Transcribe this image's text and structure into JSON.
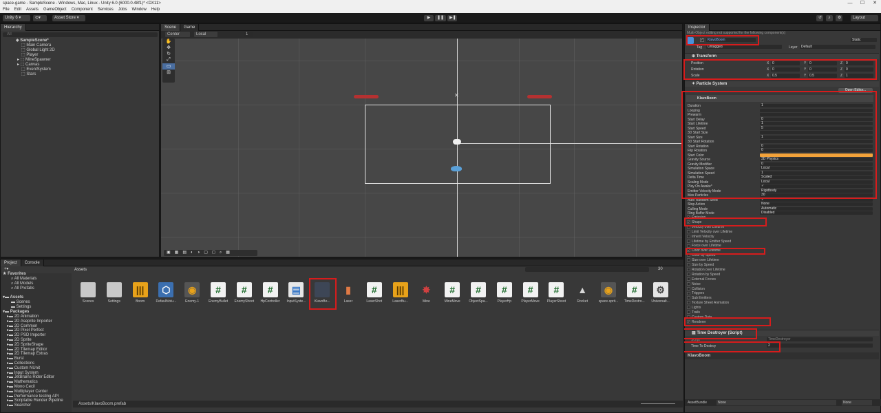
{
  "window": {
    "title": "space-game - SampleScene - Windows, Mac, Linux - Unity 6.0 (6000.0.48f1)* <DX11>",
    "min": "—",
    "max": "☐",
    "close": "✕"
  },
  "menu": [
    "File",
    "Edit",
    "Assets",
    "GameObject",
    "Component",
    "Services",
    "Jobs",
    "Window",
    "Help"
  ],
  "toolbar": {
    "account": "Unity 6",
    "account_arrow": "▾",
    "cloud": "⊙▾",
    "asset_store": "Asset Store ▾",
    "layout": "Layout",
    "play": "▶",
    "pause": "❚❚",
    "step": "▶❚"
  },
  "hierarchy": {
    "tab": "Hierarchy",
    "search_placeholder": "All",
    "items": [
      "SampleScene*",
      "Main Camera",
      "Global Light 2D",
      "Player",
      "MineSpawner",
      "Canvas",
      "EventSystem",
      "Stars"
    ]
  },
  "scene": {
    "tabs": [
      "Scene",
      "Game"
    ],
    "pivot": "Center",
    "space": "Local",
    "snap": "1"
  },
  "inspector": {
    "tab": "Inspector",
    "hint": "Multi-Object editing not supported for the following component(s)",
    "object_name": "KlavoBoom",
    "static": "Static",
    "tag_label": "Tag",
    "tag": "Untagged",
    "layer_label": "Layer",
    "layer": "Default",
    "transform": {
      "title": "Transform",
      "position_label": "Position",
      "rotation_label": "Rotation",
      "scale_label": "Scale",
      "axis_x": "X",
      "axis_y": "Y",
      "axis_z": "Z",
      "position": [
        "0",
        "0",
        "0"
      ],
      "rotation": [
        "0",
        "0",
        "0"
      ],
      "scale": [
        "0.5",
        "0.5",
        "1"
      ]
    },
    "particle": {
      "title": "Particle System",
      "open_editor": "Open Editor...",
      "sub_title": "KlavoBoom",
      "rows": [
        {
          "label": "Duration",
          "value": "1"
        },
        {
          "label": "Looping",
          "value": ""
        },
        {
          "label": "Prewarm",
          "value": ""
        },
        {
          "label": "Start Delay",
          "value": "0"
        },
        {
          "label": "Start Lifetime",
          "value": "1"
        },
        {
          "label": "Start Speed",
          "value": "5"
        },
        {
          "label": "3D Start Size",
          "value": ""
        },
        {
          "label": "Start Size",
          "value": "1"
        },
        {
          "label": "3D Start Rotation",
          "value": ""
        },
        {
          "label": "Start Rotation",
          "value": "0"
        },
        {
          "label": "Flip Rotation",
          "value": "0"
        },
        {
          "label": "Start Color",
          "value": ""
        },
        {
          "label": "Gravity Source",
          "value": "3D Physics"
        },
        {
          "label": "Gravity Modifier",
          "value": "0"
        },
        {
          "label": "Simulation Space",
          "value": "Local"
        },
        {
          "label": "Simulation Speed",
          "value": "1"
        },
        {
          "label": "Delta Time",
          "value": "Scaled"
        },
        {
          "label": "Scaling Mode",
          "value": "Local"
        },
        {
          "label": "Play On Awake*",
          "value": "✓"
        },
        {
          "label": "Emitter Velocity Mode",
          "value": "Rigidbody"
        },
        {
          "label": "Max Particles",
          "value": "30"
        },
        {
          "label": "Auto Random Seed",
          "value": "✓"
        },
        {
          "label": "Stop Action",
          "value": "None"
        },
        {
          "label": "Culling Mode",
          "value": "Automatic"
        },
        {
          "label": "Ring Buffer Mode",
          "value": "Disabled"
        }
      ],
      "modules": [
        {
          "label": "Emission",
          "checked": "✓"
        },
        {
          "label": "Shape",
          "checked": "✓"
        },
        {
          "label": "Velocity over Lifetime",
          "checked": ""
        },
        {
          "label": "Limit Velocity over Lifetime",
          "checked": ""
        },
        {
          "label": "Inherit Velocity",
          "checked": ""
        },
        {
          "label": "Lifetime by Emitter Speed",
          "checked": ""
        },
        {
          "label": "Force over Lifetime",
          "checked": ""
        },
        {
          "label": "Color over Lifetime",
          "checked": "✓"
        },
        {
          "label": "Color by Speed",
          "checked": ""
        },
        {
          "label": "Size over Lifetime",
          "checked": ""
        },
        {
          "label": "Size by Speed",
          "checked": ""
        },
        {
          "label": "Rotation over Lifetime",
          "checked": ""
        },
        {
          "label": "Rotation by Speed",
          "checked": ""
        },
        {
          "label": "External Forces",
          "checked": ""
        },
        {
          "label": "Noise",
          "checked": ""
        },
        {
          "label": "Collision",
          "checked": ""
        },
        {
          "label": "Triggers",
          "checked": ""
        },
        {
          "label": "Sub Emitters",
          "checked": ""
        },
        {
          "label": "Texture Sheet Animation",
          "checked": ""
        },
        {
          "label": "Lights",
          "checked": ""
        },
        {
          "label": "Trails",
          "checked": ""
        },
        {
          "label": "Custom Data",
          "checked": ""
        },
        {
          "label": "Renderer",
          "checked": "✓"
        }
      ]
    },
    "time_destroyer": {
      "title": "Time Destroyer (Script)",
      "script_label": "Script",
      "script": "TimeDestroyer",
      "field_label": "Time To Destroy",
      "field_value": "2"
    },
    "footer_name": "KlavoBoom",
    "assetbundle_label": "AssetBundle",
    "assetbundle_value": "None",
    "assetbundle_variant": "None",
    "start_color": "#f2a23a"
  },
  "project": {
    "tabs": [
      "Project",
      "Console"
    ],
    "favorites_label": "Favorites",
    "favorites": [
      "All Materials",
      "All Models",
      "All Prefabs"
    ],
    "assets_label": "Assets",
    "assets_children": [
      "Scenes",
      "Settings"
    ],
    "packages_label": "Packages",
    "packages": [
      "2D Animation",
      "2D Aseprite Importer",
      "2D Common",
      "2D Pixel Perfect",
      "2D PSD Importer",
      "2D Sprite",
      "2D SpriteShape",
      "2D Tilemap Editor",
      "2D Tilemap Extras",
      "Burst",
      "Collections",
      "Custom NUnit",
      "Input System",
      "JetBrains Rider Editor",
      "Mathematics",
      "Mono Cecil",
      "Multiplayer Center",
      "Performance testing API",
      "Scriptable Render Pipeline",
      "Searcher"
    ],
    "breadcrumb": "Assets",
    "slider_count": "30",
    "path": "Assets/KlavoBoom.prefab",
    "items": [
      {
        "label": "Scenes",
        "kind": "folder"
      },
      {
        "label": "Settings",
        "kind": "folder"
      },
      {
        "label": "Boom",
        "kind": "anim"
      },
      {
        "label": "DefaultVolu...",
        "kind": "cube"
      },
      {
        "label": "Enemy-1",
        "kind": "ship"
      },
      {
        "label": "EnemyBullet",
        "kind": "script"
      },
      {
        "label": "EnemyShoot",
        "kind": "script"
      },
      {
        "label": "HpController",
        "kind": "script"
      },
      {
        "label": "InputSyste...",
        "kind": "map"
      },
      {
        "label": "KlavoBo...",
        "kind": "prefab"
      },
      {
        "label": "Laser",
        "kind": "laser"
      },
      {
        "label": "LaserShot",
        "kind": "script"
      },
      {
        "label": "LaserBu...",
        "kind": "anim"
      },
      {
        "label": "Mine",
        "kind": "mine"
      },
      {
        "label": "MineMove",
        "kind": "script"
      },
      {
        "label": "ObjectSpa...",
        "kind": "script"
      },
      {
        "label": "PlayerHp",
        "kind": "script"
      },
      {
        "label": "PlayerMove",
        "kind": "script"
      },
      {
        "label": "PlayerShoot",
        "kind": "script"
      },
      {
        "label": "Rocket",
        "kind": "rocket"
      },
      {
        "label": "space-sprit...",
        "kind": "ship"
      },
      {
        "label": "TimeDestro...",
        "kind": "script"
      },
      {
        "label": "Universalt...",
        "kind": "gear"
      }
    ]
  }
}
